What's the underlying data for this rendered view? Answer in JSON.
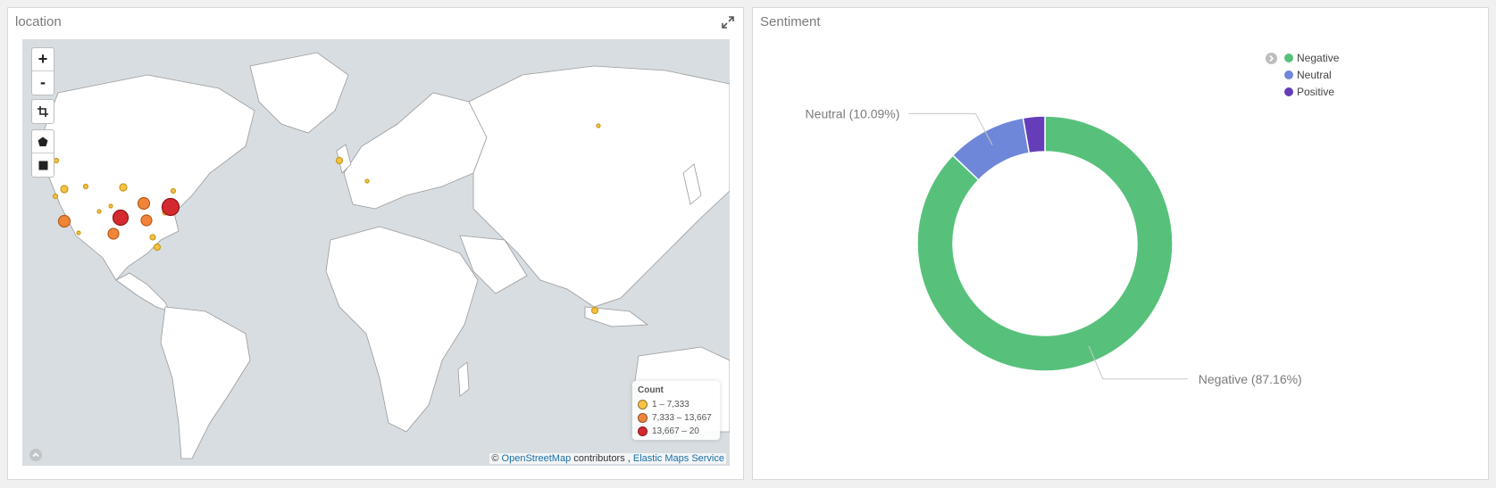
{
  "location_panel": {
    "title": "location",
    "controls": {
      "zoom_in": "+",
      "zoom_out": "-"
    },
    "legend": {
      "title": "Count",
      "items": [
        {
          "label": "1 – 7,333",
          "color": "#f7c244"
        },
        {
          "label": "7,333 – 13,667",
          "color": "#f0853a"
        },
        {
          "label": "13,667 – 20",
          "color": "#d42a2f"
        }
      ]
    },
    "attribution": {
      "prefix": "©",
      "osm": "OpenStreetMap",
      "middle": "contributors ,",
      "ems": "Elastic Maps Service"
    }
  },
  "sentiment_panel": {
    "title": "Sentiment",
    "legend": [
      {
        "label": "Negative",
        "color": "#57c17b"
      },
      {
        "label": "Neutral",
        "color": "#6f87d8"
      },
      {
        "label": "Positive",
        "color": "#663db8"
      }
    ],
    "chart_data": {
      "type": "pie",
      "donut": true,
      "categories": [
        "Negative",
        "Neutral",
        "Positive"
      ],
      "values": [
        87.16,
        10.09,
        2.75
      ],
      "unit": "%",
      "labels": [
        "Negative (87.16%)",
        "Neutral (10.09%)"
      ],
      "colors": [
        "#57c17b",
        "#6f87d8",
        "#663db8"
      ],
      "legend_position": "top-right"
    }
  }
}
